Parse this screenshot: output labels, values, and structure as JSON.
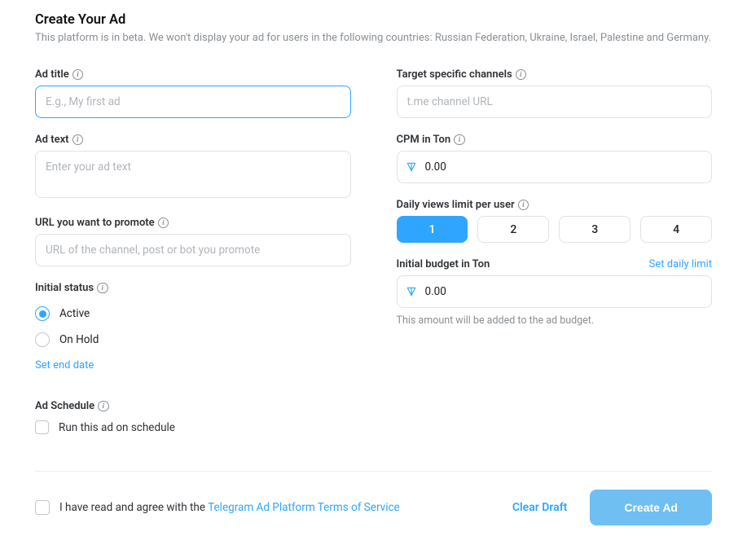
{
  "header": {
    "title": "Create Your Ad",
    "subtitle": "This platform is in beta. We won't display your ad for users in the following countries: Russian Federation, Ukraine, Israel, Palestine and Germany."
  },
  "left": {
    "ad_title": {
      "label": "Ad title",
      "placeholder": "E.g., My first ad",
      "value": ""
    },
    "ad_text": {
      "label": "Ad text",
      "placeholder": "Enter your ad text",
      "value": ""
    },
    "url": {
      "label": "URL you want to promote",
      "placeholder": "URL of the channel, post or bot you promote",
      "value": ""
    },
    "status": {
      "label": "Initial status",
      "options": [
        {
          "label": "Active",
          "selected": true
        },
        {
          "label": "On Hold",
          "selected": false
        }
      ],
      "end_date_link": "Set end date"
    },
    "schedule": {
      "label": "Ad Schedule",
      "checkbox_label": "Run this ad on schedule",
      "checked": false
    }
  },
  "right": {
    "target": {
      "label": "Target specific channels",
      "placeholder": "t.me channel URL",
      "value": ""
    },
    "cpm": {
      "label": "CPM in Ton",
      "value": "0.00"
    },
    "limit": {
      "label": "Daily views limit per user",
      "options": [
        "1",
        "2",
        "3",
        "4"
      ],
      "selected_index": 0
    },
    "budget": {
      "label": "Initial budget in Ton",
      "link": "Set daily limit",
      "value": "0.00",
      "helper": "This amount will be added to the ad budget."
    }
  },
  "footer": {
    "agree_prefix": "I have read and agree with the ",
    "agree_link_text": "Telegram Ad Platform Terms of Service",
    "clear_draft": "Clear Draft",
    "create": "Create Ad"
  },
  "colors": {
    "accent": "#2ea6ff"
  }
}
